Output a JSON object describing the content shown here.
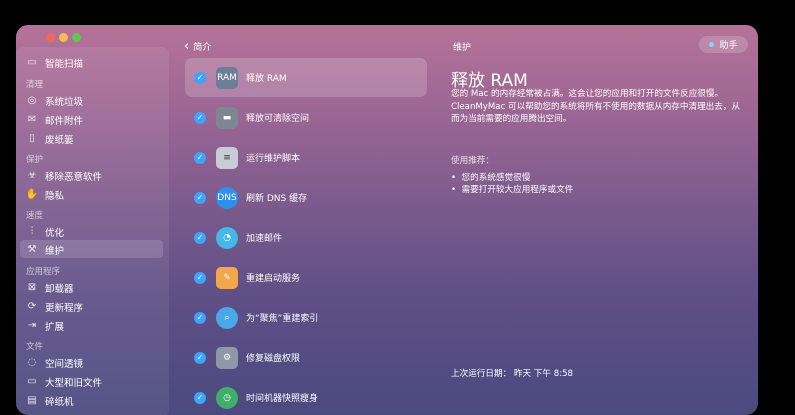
{
  "sidebar": {
    "smart_scan": "智能扫描",
    "sections": [
      {
        "header": "清理",
        "items": [
          "系统垃圾",
          "邮件附件",
          "废纸篓"
        ]
      },
      {
        "header": "保护",
        "items": [
          "移除恶意软件",
          "隐私"
        ]
      },
      {
        "header": "速度",
        "items": [
          "优化",
          "维护"
        ]
      },
      {
        "header": "应用程序",
        "items": [
          "卸载器",
          "更新程序",
          "扩展"
        ]
      },
      {
        "header": "文件",
        "items": [
          "空间透镜",
          "大型和旧文件",
          "碎纸机"
        ]
      }
    ]
  },
  "header": {
    "back_label": "简介",
    "section_title": "维护",
    "help_label": "助手"
  },
  "tasks": [
    {
      "label": "释放 RAM",
      "icon": "ram-icon",
      "color": "#6e7e96"
    },
    {
      "label": "释放可清除空间",
      "icon": "disk-icon",
      "color": "#7d8794"
    },
    {
      "label": "运行维护脚本",
      "icon": "script-icon",
      "color": "#c7ccd6"
    },
    {
      "label": "刷新 DNS 缓存",
      "icon": "dns-icon",
      "color": "#2d8ff0"
    },
    {
      "label": "加速邮件",
      "icon": "mail-speed-icon",
      "color": "#45b7e8"
    },
    {
      "label": "重建启动服务",
      "icon": "launch-services-icon",
      "color": "#f2a74a"
    },
    {
      "label": "为“聚焦”重建索引",
      "icon": "spotlight-icon",
      "color": "#4aa8e8"
    },
    {
      "label": "修复磁盘权限",
      "icon": "permission-icon",
      "color": "#8f98a8"
    },
    {
      "label": "时间机器快照瘦身",
      "icon": "time-machine-icon",
      "color": "#3fae6b"
    }
  ],
  "detail": {
    "title": "释放 RAM",
    "description": "您的 Mac 的内存经常被占满。这会让您的应用和打开的文件反应很慢。CleanMyMac 可以帮助您的系统将所有不使用的数据从内存中清理出去，从而为当前需要的应用腾出空间。",
    "usage_header": "使用推荐：",
    "usage_items": [
      "您的系统感觉很慢",
      "需要打开较大应用程序或文件"
    ],
    "last_run": "上次运行日期： 昨天 下午 8:58"
  }
}
